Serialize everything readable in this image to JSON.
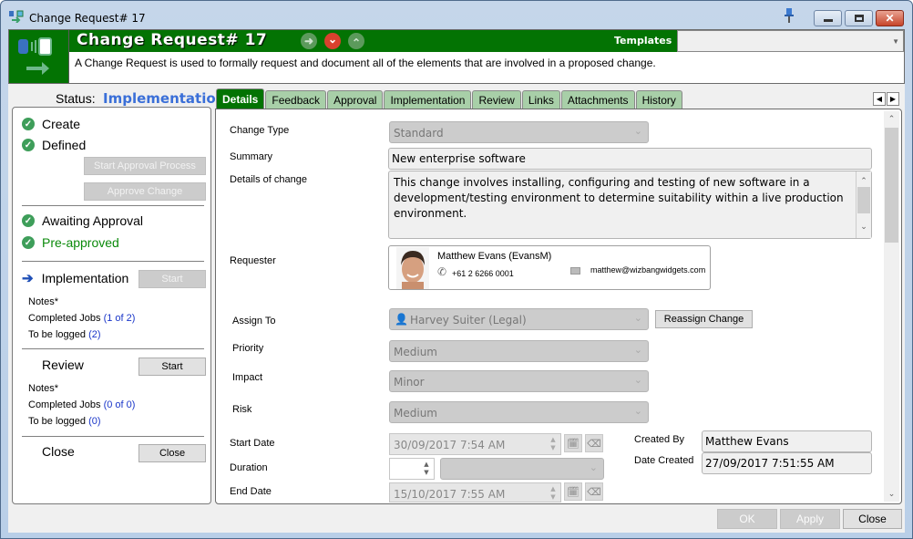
{
  "window": {
    "title": "Change Request# 17",
    "close_glyph": "✕",
    "minimize_glyph": "▭",
    "maximize_glyph": "▢"
  },
  "header": {
    "title": "Change Request# 17",
    "description": "A Change Request is used to formally request and document all of the elements that are involved in a proposed change.",
    "templates_label": "Templates",
    "templates_value": "",
    "nav": {
      "next": "➜",
      "down": "⌄",
      "up": "⌃"
    },
    "brand_color": "#037303"
  },
  "status": {
    "label": "Status:",
    "value": "Implementation"
  },
  "workflow": {
    "create": "Create",
    "defined": "Defined",
    "start_approval_button": "Start Approval Process",
    "approve_change_button": "Approve Change",
    "awaiting_approval": "Awaiting Approval",
    "pre_approved": "Pre-approved",
    "implementation": {
      "label": "Implementation",
      "start_button": "Start",
      "notes": "Notes*",
      "completed_jobs_label": "Completed Jobs",
      "completed_jobs_value": "(1 of 2)",
      "to_be_logged_label": "To be logged",
      "to_be_logged_value": "(2)"
    },
    "review": {
      "label": "Review",
      "start_button": "Start",
      "notes": "Notes*",
      "completed_jobs_label": "Completed Jobs",
      "completed_jobs_value": "(0 of 0)",
      "to_be_logged_label": "To be logged",
      "to_be_logged_value": "(0)"
    },
    "close": {
      "label": "Close",
      "button": "Close"
    }
  },
  "tabs": [
    {
      "label": "Details",
      "active": true
    },
    {
      "label": "Feedback",
      "active": false
    },
    {
      "label": "Approval",
      "active": false
    },
    {
      "label": "Implementation",
      "active": false
    },
    {
      "label": "Review",
      "active": false
    },
    {
      "label": "Links",
      "active": false
    },
    {
      "label": "Attachments",
      "active": false
    },
    {
      "label": "History",
      "active": false
    }
  ],
  "form": {
    "change_type": {
      "label": "Change Type",
      "value": "Standard"
    },
    "summary": {
      "label": "Summary",
      "value": "New enterprise software"
    },
    "details": {
      "label": "Details of change",
      "value": "This change involves installing, configuring and testing of new software in a development/testing environment to determine suitability within a live production environment."
    },
    "requester": {
      "label": "Requester",
      "name": "Matthew Evans (EvansM)",
      "phone": "+61 2 6266 0001",
      "email": "matthew@wizbangwidgets.com"
    },
    "assign_to": {
      "label": "Assign To",
      "value": "Harvey Suiter (Legal)",
      "reassign_button": "Reassign Change"
    },
    "priority": {
      "label": "Priority",
      "value": "Medium"
    },
    "impact": {
      "label": "Impact",
      "value": "Minor"
    },
    "risk": {
      "label": "Risk",
      "value": "Medium"
    },
    "start_date": {
      "label": "Start Date",
      "value": "30/09/2017 7:54 AM"
    },
    "duration": {
      "label": "Duration",
      "value": "",
      "unit": ""
    },
    "end_date": {
      "label": "End Date",
      "value": "15/10/2017 7:55 AM"
    },
    "created_by": {
      "label": "Created By",
      "value": "Matthew Evans"
    },
    "date_created": {
      "label": "Date Created",
      "value": "27/09/2017 7:51:55 AM"
    }
  },
  "footer": {
    "ok": "OK",
    "apply": "Apply",
    "close": "Close"
  }
}
